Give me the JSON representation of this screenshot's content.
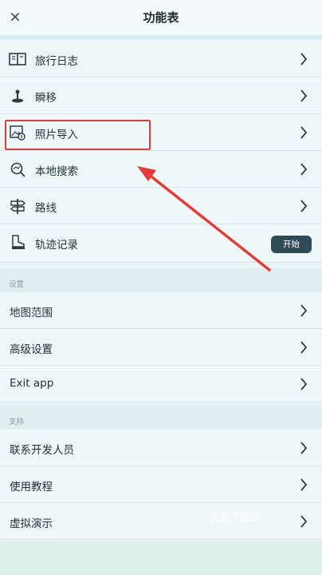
{
  "header": {
    "title": "功能表",
    "close_icon": "×"
  },
  "menu": [
    {
      "label": "旅行日志",
      "icon": "journal-icon"
    },
    {
      "label": "瞬移",
      "icon": "joystick-icon"
    },
    {
      "label": "照片导入",
      "icon": "photo-import-icon"
    },
    {
      "label": "本地搜索",
      "icon": "local-search-icon"
    },
    {
      "label": "路线",
      "icon": "signpost-icon"
    },
    {
      "label": "轨迹记录",
      "icon": "boot-icon",
      "button": "开始"
    }
  ],
  "settings": {
    "header": "设置",
    "items": [
      {
        "label": "地图范围"
      },
      {
        "label": "高级设置"
      },
      {
        "label": "Exit app"
      }
    ]
  },
  "support": {
    "header": "支持",
    "items": [
      {
        "label": "联系开发人员"
      },
      {
        "label": "使用教程"
      },
      {
        "label": "虚拟演示"
      }
    ]
  },
  "watermark": "沃屋下载站",
  "colors": {
    "highlight": "#e53c3a",
    "button": "#2f4c56",
    "background": "#eaf5f5"
  }
}
